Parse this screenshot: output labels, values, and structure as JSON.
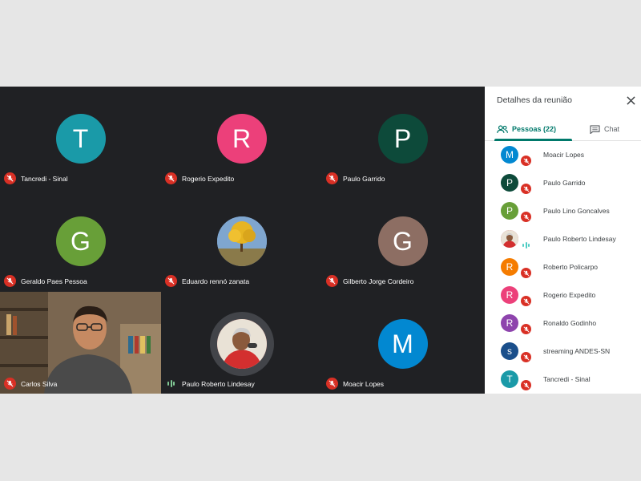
{
  "tiles": [
    {
      "name": "Tancredi - Sinal",
      "initial": "T",
      "color": "#1a9aa8",
      "mic": "muted"
    },
    {
      "name": "Rogerio Expedito",
      "initial": "R",
      "color": "#ec407a",
      "mic": "muted"
    },
    {
      "name": "Paulo Garrido",
      "initial": "P",
      "color": "#0d4a3a",
      "mic": "muted"
    },
    {
      "name": "Geraldo Paes Pessoa",
      "initial": "G",
      "color": "#689f38",
      "mic": "muted"
    },
    {
      "name": "Eduardo rennó zanata",
      "initial": "",
      "color": "#7aa0c8",
      "mic": "muted"
    },
    {
      "name": "Gilberto Jorge Cordeiro",
      "initial": "G",
      "color": "#8d6e63",
      "mic": "muted"
    },
    {
      "name": "Carlos Silva",
      "initial": "",
      "color": "#6b5a45",
      "mic": "muted"
    },
    {
      "name": "Paulo Roberto Lindesay",
      "initial": "",
      "color": "#c62828",
      "mic": "speaking"
    },
    {
      "name": "Moacir Lopes",
      "initial": "M",
      "color": "#0288d1",
      "mic": "muted"
    }
  ],
  "panel": {
    "title": "Detalhes da reunião",
    "tab_people": "Pessoas (22)",
    "tab_chat": "Chat",
    "people": [
      {
        "name": "Moacir Lopes",
        "initial": "M",
        "color": "#0288d1",
        "mic": "muted"
      },
      {
        "name": "Paulo Garrido",
        "initial": "P",
        "color": "#0d4a3a",
        "mic": "muted"
      },
      {
        "name": "Paulo Lino Goncalves",
        "initial": "P",
        "color": "#689f38",
        "mic": "muted"
      },
      {
        "name": "Paulo Roberto Lindesay",
        "initial": "",
        "color": "#c62828",
        "mic": "speaking"
      },
      {
        "name": "Roberto Policarpo",
        "initial": "R",
        "color": "#f57c00",
        "mic": "muted"
      },
      {
        "name": "Rogerio Expedito",
        "initial": "R",
        "color": "#ec407a",
        "mic": "muted"
      },
      {
        "name": "Ronaldo Godinho",
        "initial": "R",
        "color": "#8e44ad",
        "mic": "muted"
      },
      {
        "name": "streaming ANDES-SN",
        "initial": "s",
        "color": "#1a4f8b",
        "mic": "muted"
      },
      {
        "name": "Tancredi - Sinal",
        "initial": "T",
        "color": "#1a9aa8",
        "mic": "muted"
      }
    ]
  }
}
